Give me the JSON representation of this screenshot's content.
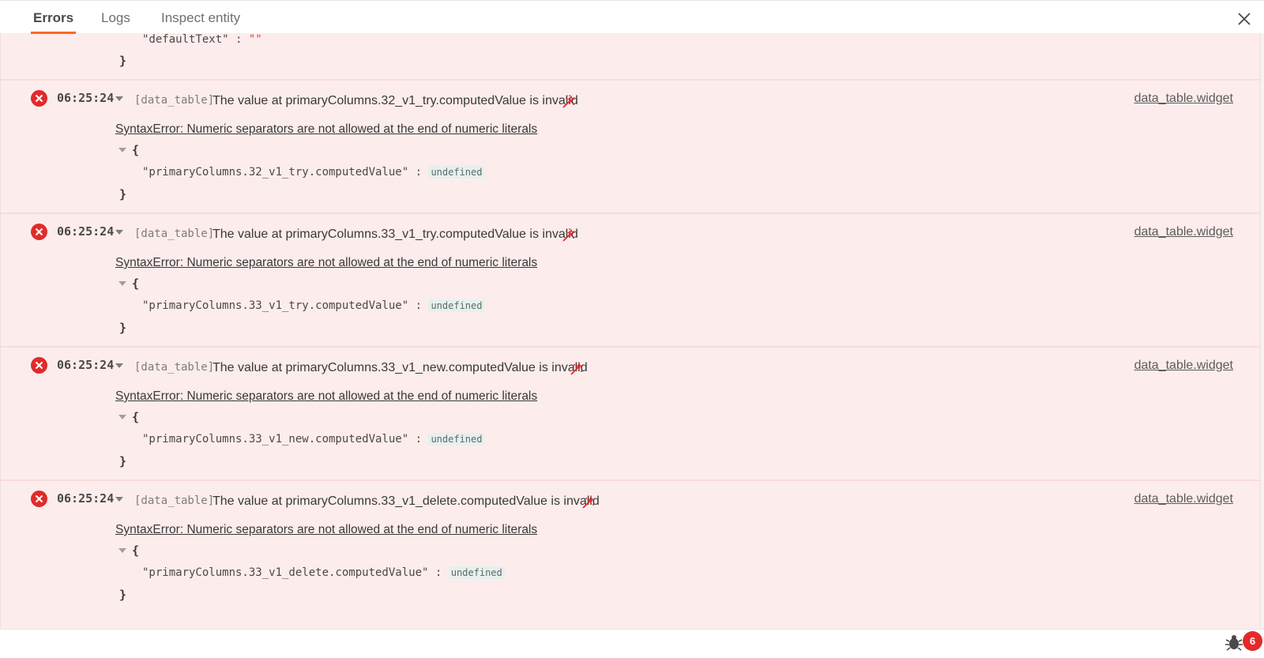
{
  "tabs": [
    {
      "label": "Errors"
    },
    {
      "label": "Logs"
    },
    {
      "label": "Inspect entity"
    }
  ],
  "previous": {
    "key": "\"defaultText\"",
    "separator": " : ",
    "value": "\"\"",
    "brace": "}"
  },
  "entries": [
    {
      "time": "06:25:24",
      "source": "[data_table]",
      "message": "The value at primaryColumns.32_v1_try.computedValue is invalid",
      "detail": "SyntaxError: Numeric separators are not allowed at the end of numeric literals",
      "entity": "data_table.widget",
      "brace_open": "{",
      "key": "\"primaryColumns.32_v1_try.computedValue\"",
      "separator": " : ",
      "value": "undefined",
      "brace_close": "}"
    },
    {
      "time": "06:25:24",
      "source": "[data_table]",
      "message": "The value at primaryColumns.33_v1_try.computedValue is invalid",
      "detail": "SyntaxError: Numeric separators are not allowed at the end of numeric literals",
      "entity": "data_table.widget",
      "brace_open": "{",
      "key": "\"primaryColumns.33_v1_try.computedValue\"",
      "separator": " : ",
      "value": "undefined",
      "brace_close": "}"
    },
    {
      "time": "06:25:24",
      "source": "[data_table]",
      "message": "The value at primaryColumns.33_v1_new.computedValue is invalid",
      "detail": "SyntaxError: Numeric separators are not allowed at the end of numeric literals",
      "entity": "data_table.widget",
      "brace_open": "{",
      "key": "\"primaryColumns.33_v1_new.computedValue\"",
      "separator": " : ",
      "value": "undefined",
      "brace_close": "}"
    },
    {
      "time": "06:25:24",
      "source": "[data_table]",
      "message": "The value at primaryColumns.33_v1_delete.computedValue is invalid",
      "detail": "SyntaxError: Numeric separators are not allowed at the end of numeric literals",
      "entity": "data_table.widget",
      "brace_open": "{",
      "key": "\"primaryColumns.33_v1_delete.computedValue\"",
      "separator": " : ",
      "value": "undefined",
      "brace_close": "}"
    }
  ],
  "debugger": {
    "badge_count": "6"
  },
  "icons": {
    "close": "close-icon",
    "error": "error-circle-icon",
    "wand": "magic-wand-icon",
    "bug": "bug-icon"
  },
  "colors": {
    "accent": "#f86a2b",
    "error": "#e22a2a",
    "panel_bg": "#fdecec"
  }
}
